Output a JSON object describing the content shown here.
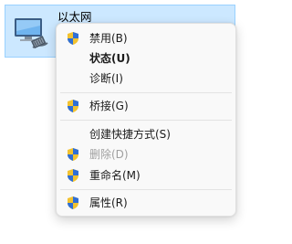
{
  "adapter": {
    "name": "以太网",
    "icon": "network-adapter-icon"
  },
  "menu": {
    "items": [
      {
        "label": "禁用(B)",
        "icon": "uac-shield-icon"
      },
      {
        "label": "状态(U)",
        "bold": true
      },
      {
        "label": "诊断(I)"
      },
      {
        "label": "桥接(G)",
        "icon": "uac-shield-icon"
      },
      {
        "label": "创建快捷方式(S)"
      },
      {
        "label": "删除(D)",
        "icon": "uac-shield-icon",
        "disabled": true
      },
      {
        "label": "重命名(M)",
        "icon": "uac-shield-icon"
      },
      {
        "label": "属性(R)",
        "icon": "uac-shield-icon"
      }
    ]
  },
  "colors": {
    "selection_bg": "#cce8ff",
    "selection_border": "#99d1ff",
    "shield_blue": "#2f6fd6",
    "shield_yellow": "#f2c230"
  }
}
